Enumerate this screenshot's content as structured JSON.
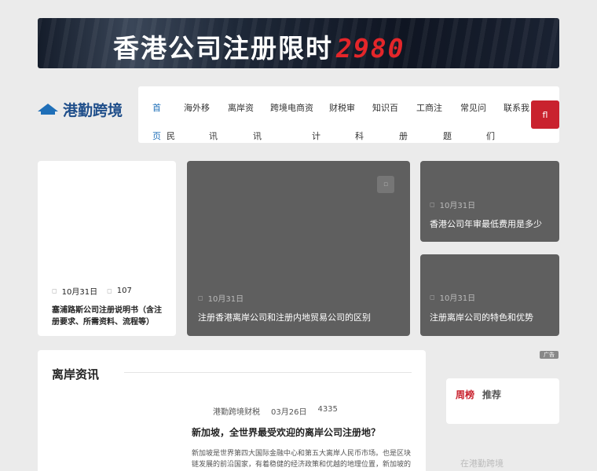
{
  "banner": {
    "text": "香港公司注册限时",
    "price": "2980"
  },
  "logo": {
    "text": "港勤跨境"
  },
  "nav": {
    "items": [
      {
        "top": "首",
        "bottom": "页"
      },
      {
        "top": "海外移",
        "bottom": "民"
      },
      {
        "top": "离岸资",
        "bottom": "讯"
      },
      {
        "top": "跨境电商资",
        "bottom": "讯"
      },
      {
        "top": "财税审",
        "bottom": "计"
      },
      {
        "top": "知识百",
        "bottom": "科"
      },
      {
        "top": "工商注",
        "bottom": "册"
      },
      {
        "top": "常见问",
        "bottom": "题"
      },
      {
        "top": "联系我",
        "bottom": "们"
      }
    ],
    "search_glyph": "fl"
  },
  "cards": {
    "left": {
      "date": "10月31日",
      "views": "107",
      "title": "塞浦路斯公司注册说明书（含注册要求、所需资料、流程等）"
    },
    "center": {
      "date": "10月31日",
      "title": "注册香港离岸公司和注册内地贸易公司的区别"
    },
    "right_top": {
      "date": "10月31日",
      "title": "香港公司年审最低费用是多少"
    },
    "right_bottom": {
      "date": "10月31日",
      "title": "注册离岸公司的特色和优势"
    }
  },
  "ad_label": "广告",
  "news": {
    "heading": "离岸资讯",
    "author": "港勤跨境财税",
    "date": "03月26日",
    "views": "4335",
    "title": "新加坡，全世界最受欢迎的离岸公司注册地？",
    "summary": "新加坡是世界第四大国际金融中心和第五大离岸人民币市场。也是区块链发展的前沿国家，有着稳健的经济政策和优越的地理位置，新加坡的金融和税务政策也吸引了越来越多的投资者前来注册公司。"
  },
  "sidebar": {
    "tab_week": "周榜",
    "tab_recommend": "推荐",
    "faded": "在港勤跨境"
  },
  "colors": {
    "accent": "#c9222e",
    "brand": "#1f6fb8",
    "card_dark": "#5f5f5f"
  }
}
